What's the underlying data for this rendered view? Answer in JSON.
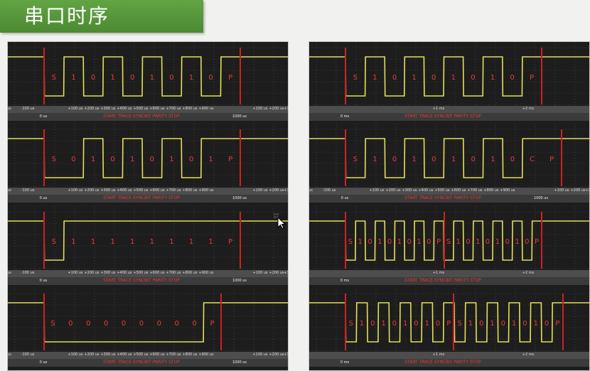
{
  "title": "串口时序",
  "colors": {
    "signal": "#e2e05a",
    "marker": "#d11f1f",
    "bits": "#e83a3a",
    "grid": "#555555",
    "screen": "#1d1d1d",
    "title_bg": "#56983b"
  },
  "decode_text": "START  TRACE  SYNCBIT  PARITY  STOP",
  "panels": [
    {
      "side": "left",
      "scopes": [
        {
          "bits": [
            "S",
            "1",
            "0",
            "1",
            "0",
            "1",
            "0",
            "1",
            "0",
            "P"
          ],
          "axis": {
            "zero": "0 us",
            "ticks": [
              "us",
              "-100 us",
              "+100 us",
              "+200 us",
              "+300 us",
              "+400 us",
              "+500 us",
              "+600 us",
              "+700 us",
              "+800 us",
              "+900 us",
              "+100 us",
              "+200 us",
              "+3"
            ],
            "end": "1000 us"
          }
        },
        {
          "bits": [
            "S",
            "0",
            "1",
            "0",
            "1",
            "0",
            "1",
            "0",
            "1",
            "P"
          ],
          "axis": {
            "zero": "0 us",
            "ticks": [
              "us",
              "-100 us",
              "+100 us",
              "+200 us",
              "+300 us",
              "+400 us",
              "+500 us",
              "+600 us",
              "+700 us",
              "+800 us",
              "+900 us",
              "+100 us",
              "+200 us",
              "+3"
            ],
            "end": "1000 us"
          }
        },
        {
          "bits": [
            "S",
            "1",
            "1",
            "1",
            "1",
            "1",
            "1",
            "1",
            "1",
            "P"
          ],
          "axis": {
            "zero": "0 us",
            "ticks": [
              "us",
              "-100 us",
              "+100 us",
              "+200 us",
              "+300 us",
              "+400 us",
              "+500 us",
              "+600 us",
              "+700 us",
              "+800 us",
              "+900 us",
              "+100 us",
              "+200 us",
              "+3"
            ],
            "end": "1000 us"
          }
        },
        {
          "bits": [
            "S",
            "0",
            "0",
            "0",
            "0",
            "0",
            "0",
            "0",
            "0",
            "P"
          ],
          "axis": {
            "zero": "0 us",
            "ticks": [
              "us",
              "-100 us",
              "+100 us",
              "+200 us",
              "+300 us",
              "+400 us",
              "+500 us",
              "+600 us",
              "+700 us",
              "+800 us",
              "+900 us",
              "+100 us",
              "+200 us",
              "+3"
            ],
            "end": "1000 us"
          }
        }
      ]
    },
    {
      "side": "right",
      "scopes": [
        {
          "bits": [
            "S",
            "1",
            "0",
            "1",
            "0",
            "1",
            "0",
            "1",
            "0",
            "P"
          ],
          "axis": {
            "zero": "0 ms",
            "ticks": [
              "+1 ms",
              "+2 ms"
            ],
            "end": ""
          }
        },
        {
          "bits": [
            "S",
            "1",
            "0",
            "1",
            "0",
            "1",
            "0",
            "1",
            "0",
            "C",
            "P"
          ],
          "axis": {
            "zero": "0 us",
            "ticks": [
              "us",
              "-100 us",
              "+100 us",
              "+200 us",
              "+300 us",
              "+400 us",
              "+500 us",
              "+600 us",
              "+700 us",
              "+800 us",
              "+900 us",
              "+100 us",
              "+200 us",
              "+3"
            ],
            "end": "1000 us"
          }
        },
        {
          "bits": [
            "S",
            "1",
            "0",
            "1",
            "0",
            "1",
            "0",
            "1",
            "0",
            "P",
            "S",
            "1",
            "0",
            "1",
            "0",
            "1",
            "0",
            "1",
            "0",
            "P"
          ],
          "axis": {
            "zero": "0 ms",
            "ticks": [
              "+1 ms",
              "+2 ms"
            ],
            "end": ""
          }
        },
        {
          "bits": [
            "S",
            "1",
            "0",
            "1",
            "0",
            "1",
            "0",
            "1",
            "0",
            "P",
            "S",
            "1",
            "0",
            "1",
            "0",
            "1",
            "0",
            "1",
            "0",
            "P"
          ],
          "axis": {
            "zero": "0 ms",
            "ticks": [
              "+1 ms",
              "+2 ms"
            ],
            "end": ""
          }
        }
      ]
    }
  ]
}
